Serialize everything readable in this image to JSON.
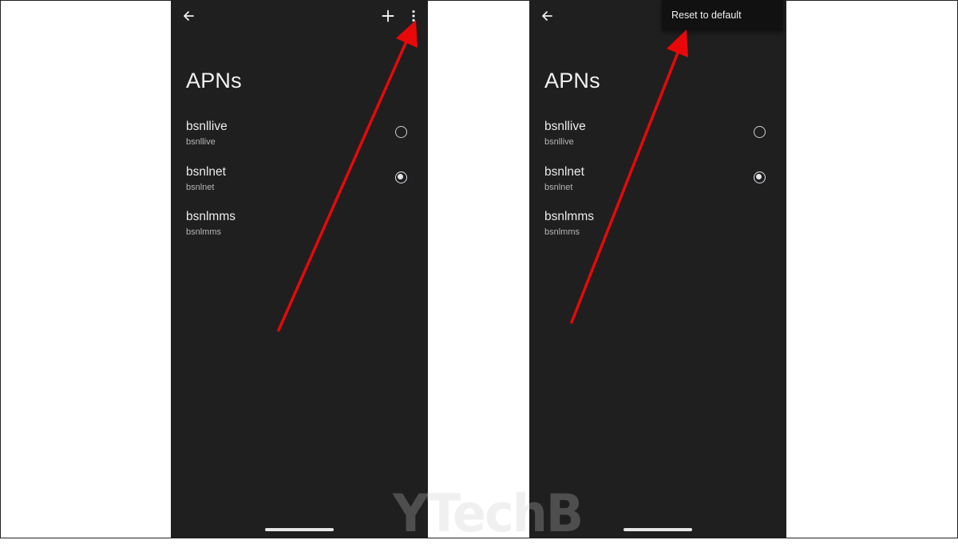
{
  "watermark": {
    "text": "YTechB"
  },
  "colors": {
    "screen_background": "#1f1f1f",
    "arrow": "#e8080a",
    "text_primary": "#ececec",
    "text_secondary": "#b5b5b5"
  },
  "screens": [
    {
      "id": "before-menu",
      "top_bar": {
        "back_icon": "arrow-back-icon",
        "add_icon": "plus-icon",
        "more_icon": "more-vert-icon"
      },
      "title": "APNs",
      "apns": [
        {
          "name": "bsnllive",
          "apn": "bsnllive",
          "selected": false
        },
        {
          "name": "bsnlnet",
          "apn": "bsnlnet",
          "selected": true
        },
        {
          "name": "bsnlmms",
          "apn": "bsnlmms",
          "selected": false
        }
      ]
    },
    {
      "id": "menu-open",
      "top_bar": {
        "back_icon": "arrow-back-icon"
      },
      "overflow_menu": {
        "items": [
          "Reset to default"
        ]
      },
      "title": "APNs",
      "apns": [
        {
          "name": "bsnllive",
          "apn": "bsnllive",
          "selected": false
        },
        {
          "name": "bsnlnet",
          "apn": "bsnlnet",
          "selected": true
        },
        {
          "name": "bsnlmms",
          "apn": "bsnlmms",
          "selected": false
        }
      ]
    }
  ]
}
